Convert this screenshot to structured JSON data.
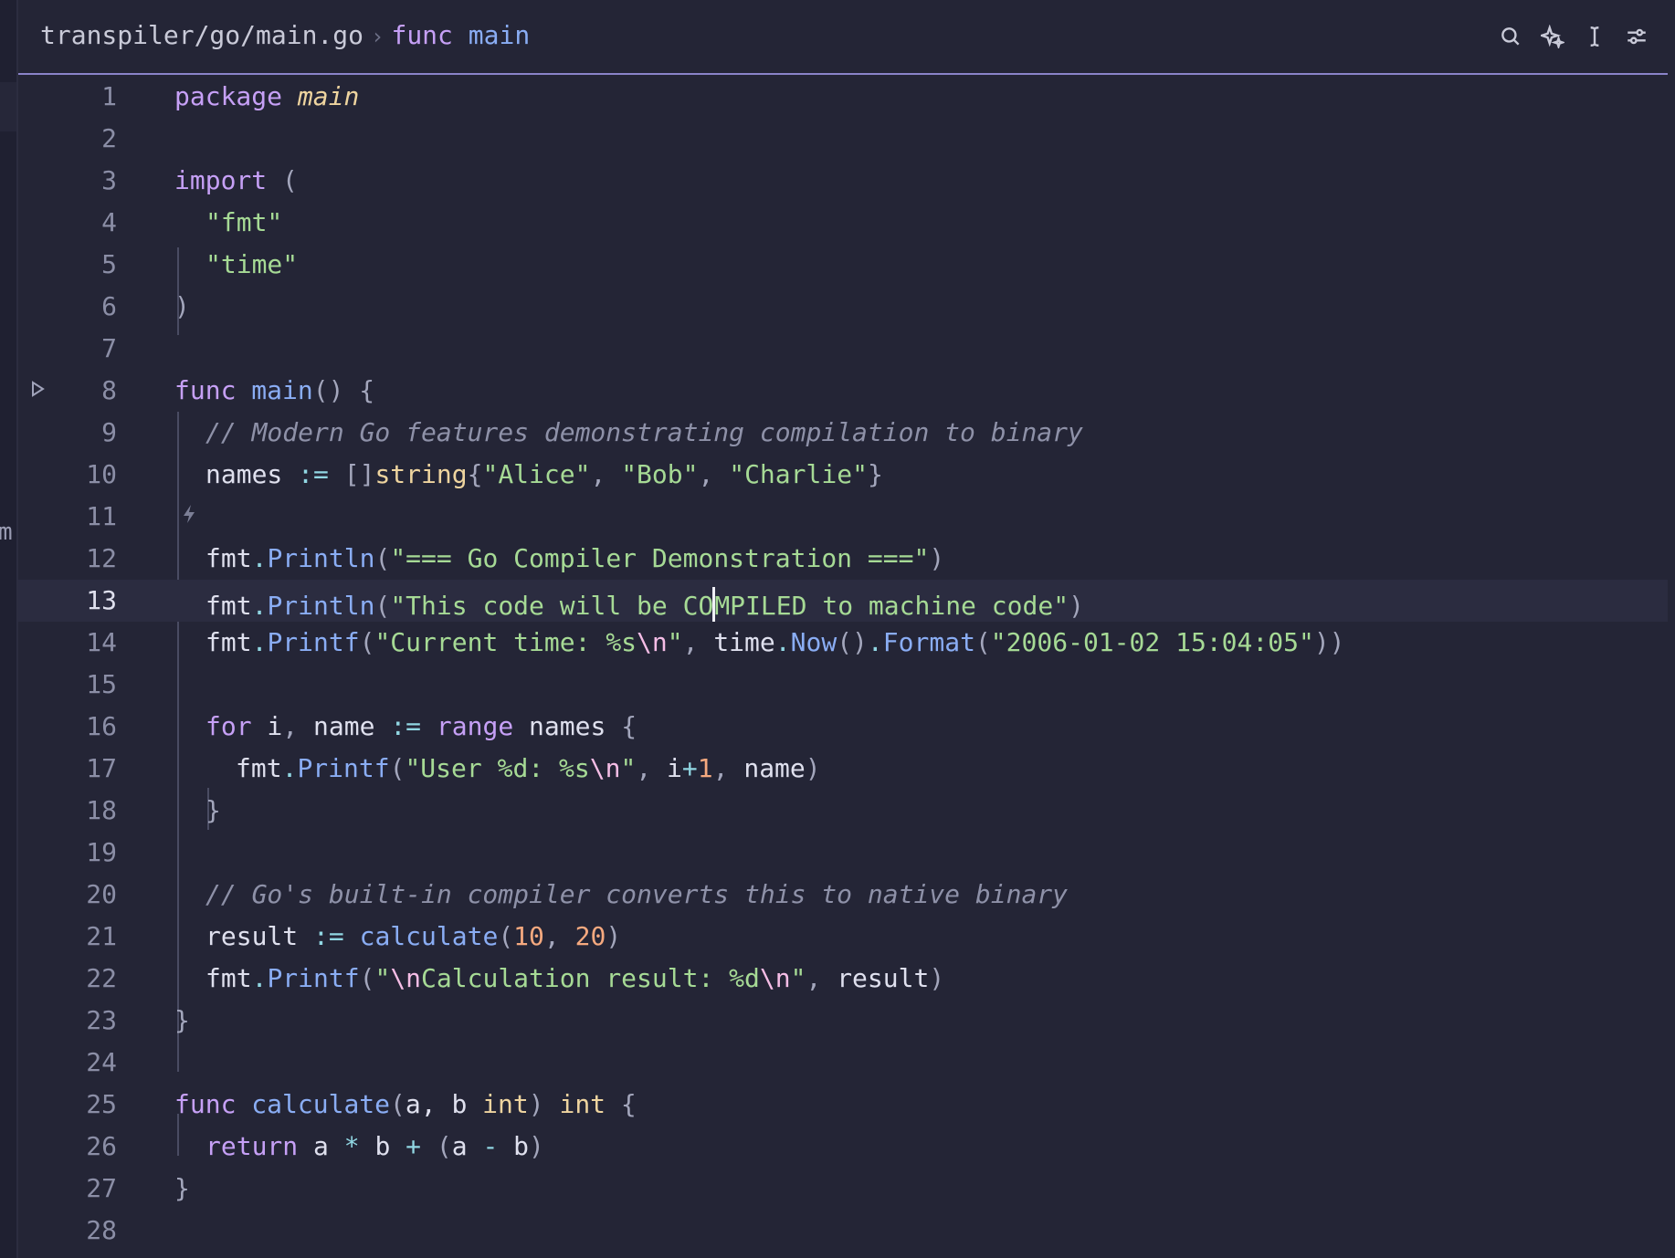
{
  "breadcrumb": {
    "path": "transpiler/go/main.go",
    "separator": "›",
    "symbol_kind": "func",
    "symbol_name": "main"
  },
  "toolbar": {
    "icons": [
      "search-icon",
      "sparkle-ai-icon",
      "text-cursor-icon",
      "sliders-icon"
    ]
  },
  "left_strip_char": "m",
  "editor": {
    "current_line": 13,
    "lines": [
      {
        "n": "1"
      },
      {
        "n": "2"
      },
      {
        "n": "3"
      },
      {
        "n": "4"
      },
      {
        "n": "5"
      },
      {
        "n": "6"
      },
      {
        "n": "7"
      },
      {
        "n": "8"
      },
      {
        "n": "9"
      },
      {
        "n": "10"
      },
      {
        "n": "11"
      },
      {
        "n": "12"
      },
      {
        "n": "13"
      },
      {
        "n": "14"
      },
      {
        "n": "15"
      },
      {
        "n": "16"
      },
      {
        "n": "17"
      },
      {
        "n": "18"
      },
      {
        "n": "19"
      },
      {
        "n": "20"
      },
      {
        "n": "21"
      },
      {
        "n": "22"
      },
      {
        "n": "23"
      },
      {
        "n": "24"
      },
      {
        "n": "25"
      },
      {
        "n": "26"
      },
      {
        "n": "27"
      },
      {
        "n": "28"
      }
    ],
    "code": {
      "l1_kw": "package",
      "l1_pkg": "main",
      "l3_kw": "import",
      "l3_paren": "(",
      "l4_str": "\"fmt\"",
      "l5_str": "\"time\"",
      "l6_paren": ")",
      "l8_kw": "func",
      "l8_fn": "main",
      "l8_rest": "() {",
      "l9_com": "// Modern Go features demonstrating compilation to binary",
      "l10_id": "names",
      "l10_op": ":=",
      "l10_br": "[]",
      "l10_type": "string",
      "l10_lb": "{",
      "l10_s1": "\"Alice\"",
      "l10_c1": ", ",
      "l10_s2": "\"Bob\"",
      "l10_c2": ", ",
      "l10_s3": "\"Charlie\"",
      "l10_rb": "}",
      "l12_id": "fmt",
      "l12_dot": ".",
      "l12_fn": "Println",
      "l12_lp": "(",
      "l12_str": "\"=== Go Compiler Demonstration ===\"",
      "l12_rp": ")",
      "l13_id": "fmt",
      "l13_dot": ".",
      "l13_fn": "Println",
      "l13_lp": "(",
      "l13_str_a": "\"This code will be CO",
      "l13_str_b": "MPILED to machine code\"",
      "l13_rp": ")",
      "l14_id": "fmt",
      "l14_dot": ".",
      "l14_fn": "Printf",
      "l14_lp": "(",
      "l14_str": "\"Current time: %s",
      "l14_esc": "\\n",
      "l14_q": "\"",
      "l14_c": ", ",
      "l14_id2": "time",
      "l14_dot2": ".",
      "l14_fn2": "Now",
      "l14_p2": "()",
      "l14_dot3": ".",
      "l14_fn3": "Format",
      "l14_lp3": "(",
      "l14_str2": "\"2006-01-02 15:04:05\"",
      "l14_rp3": "))",
      "l16_kw": "for",
      "l16_id": " i",
      "l16_c": ", ",
      "l16_id2": "name ",
      "l16_op": ":=",
      "l16_kw2": " range",
      "l16_id3": " names ",
      "l16_lb": "{",
      "l17_id": "fmt",
      "l17_dot": ".",
      "l17_fn": "Printf",
      "l17_lp": "(",
      "l17_str": "\"User %d: %s",
      "l17_esc": "\\n",
      "l17_q": "\"",
      "l17_c": ", ",
      "l17_id2": "i",
      "l17_op": "+",
      "l17_num": "1",
      "l17_c2": ", ",
      "l17_id3": "name",
      "l17_rp": ")",
      "l18_rb": "}",
      "l20_com": "// Go's built-in compiler converts this to native binary",
      "l21_id": "result ",
      "l21_op": ":=",
      "l21_fn": " calculate",
      "l21_lp": "(",
      "l21_n1": "10",
      "l21_c": ", ",
      "l21_n2": "20",
      "l21_rp": ")",
      "l22_id": "fmt",
      "l22_dot": ".",
      "l22_fn": "Printf",
      "l22_lp": "(",
      "l22_q1": "\"",
      "l22_esc1": "\\n",
      "l22_str": "Calculation result: %d",
      "l22_esc2": "\\n",
      "l22_q2": "\"",
      "l22_c": ", ",
      "l22_id2": "result",
      "l22_rp": ")",
      "l23_rb": "}",
      "l25_kw": "func",
      "l25_fn": " calculate",
      "l25_lp": "(",
      "l25_params": "a, b ",
      "l25_type": "int",
      "l25_rp": ") ",
      "l25_type2": "int",
      "l25_lb": " {",
      "l26_kw": "return",
      "l26_a": " a ",
      "l26_op1": "*",
      "l26_b": " b ",
      "l26_op2": "+",
      "l26_lp": " (",
      "l26_a2": "a ",
      "l26_op3": "-",
      "l26_b2": " b",
      "l26_rp": ")",
      "l27_rb": "}"
    }
  },
  "colors": {
    "background": "#242536",
    "accent_border": "#8a84c9",
    "keyword": "#c6a0f6",
    "string": "#a6da95",
    "function": "#8aadf4",
    "type": "#eed49f",
    "number": "#f5a97f",
    "comment": "#8e91a8"
  }
}
